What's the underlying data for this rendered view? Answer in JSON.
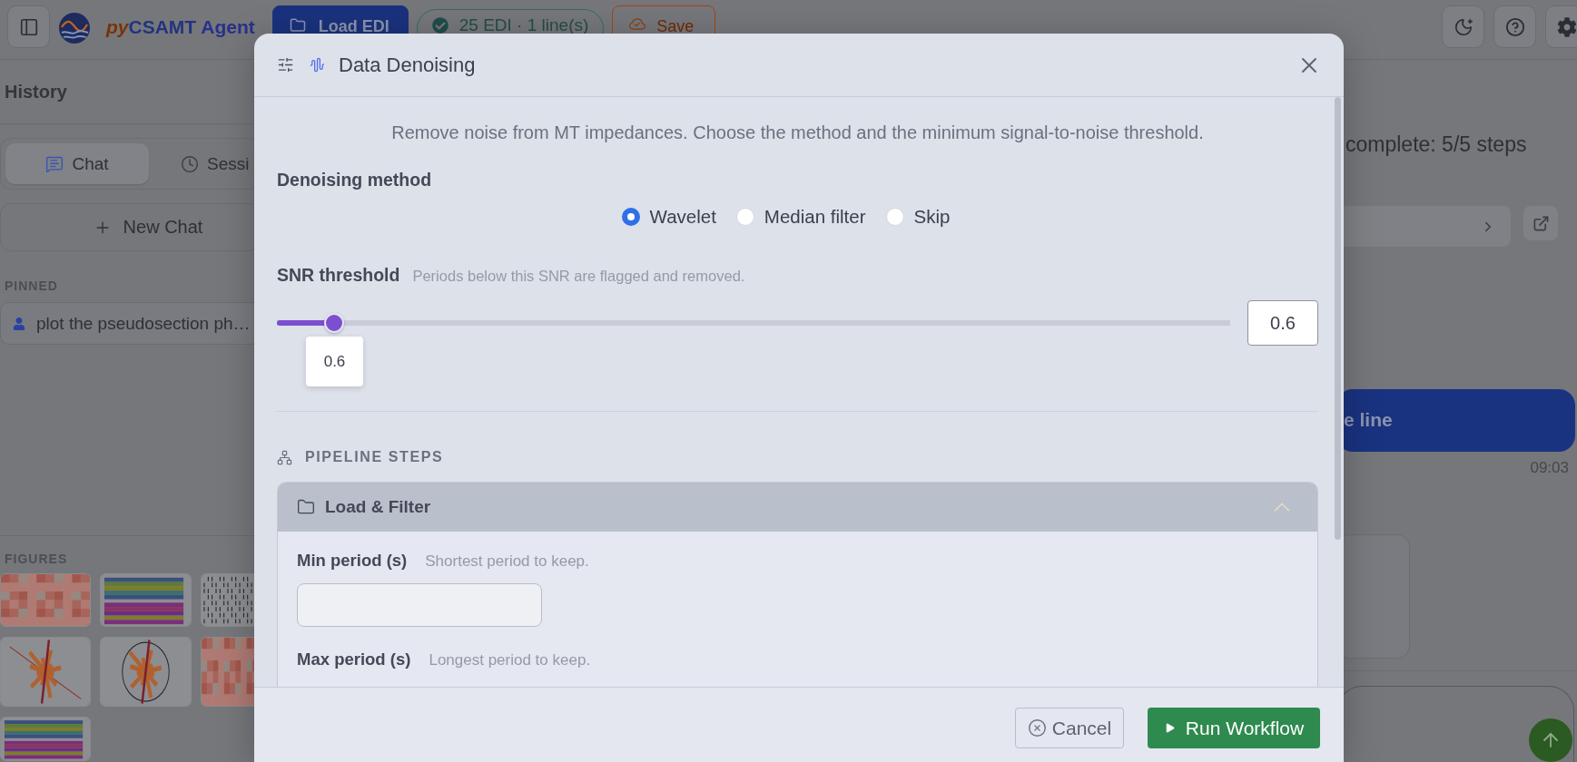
{
  "header": {
    "brand": {
      "prefix": "py",
      "name": "CSAMT",
      "suffix": "Agent"
    },
    "actions": [
      {
        "kind": "load",
        "label": "Load EDI"
      },
      {
        "kind": "status",
        "label": "25 EDI · 1 line(s)"
      },
      {
        "kind": "save",
        "label": "Save"
      }
    ]
  },
  "sidebar": {
    "title": "History",
    "tabs": [
      {
        "label": "Chat",
        "selected": true
      },
      {
        "label": "Sessi",
        "selected": false
      }
    ],
    "new_chat": "New Chat",
    "pinned": {
      "title": "PINNED",
      "items": [
        {
          "label": "plot the pseudosection ph…"
        }
      ]
    },
    "figures": {
      "title": "FIGURES",
      "thumbnails": [
        {
          "kind": "heatmap"
        },
        {
          "kind": "bands"
        },
        {
          "kind": "dots"
        },
        {
          "kind": "rose"
        },
        {
          "kind": "polar"
        },
        {
          "kind": "heatmap"
        },
        {
          "kind": "bands"
        }
      ]
    }
  },
  "chat": {
    "messages": [
      {
        "kind": "status",
        "text": "complete: 5/5 steps"
      },
      {
        "kind": "result"
      },
      {
        "kind": "user",
        "text": "e line",
        "time": "09:03"
      },
      {
        "kind": "figure"
      }
    ]
  },
  "modal": {
    "title": "Data Denoising",
    "description": "Remove noise from MT impedances. Choose the method and the minimum signal-to-noise threshold.",
    "method": {
      "label": "Denoising method",
      "options": [
        {
          "label": "Wavelet",
          "selected": true
        },
        {
          "label": "Median filter",
          "selected": false
        },
        {
          "label": "Skip",
          "selected": false
        }
      ]
    },
    "snr": {
      "label": "SNR threshold",
      "hint": "Periods below this SNR are flagged and removed.",
      "level": 0.06,
      "tooltip": "0.6",
      "value": "0.6"
    },
    "pipeline": {
      "title": "PIPELINE STEPS",
      "steps": [
        {
          "title": "Load & Filter",
          "expanded": true,
          "fields": [
            {
              "label": "Min period (s)",
              "hint": "Shortest period to keep.",
              "kind": "input"
            },
            {
              "label": "Max period (s)",
              "hint": "Longest period to keep.",
              "kind": "label"
            }
          ]
        }
      ]
    },
    "buttons": [
      {
        "kind": "secondary",
        "label": "Cancel"
      },
      {
        "kind": "primary",
        "label": "Run Workflow"
      }
    ]
  }
}
